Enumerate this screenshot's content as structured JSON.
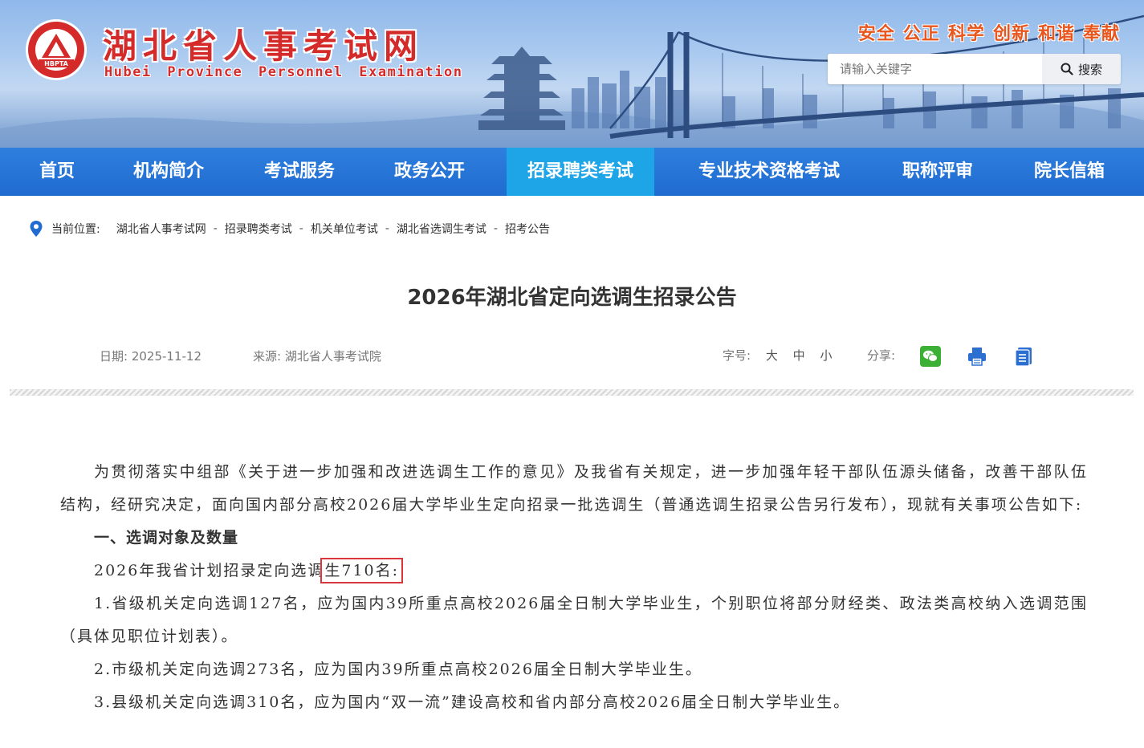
{
  "header": {
    "logo_mark": "HBPTA",
    "site_name": "湖北省人事考试网",
    "site_name_en": "Hubei Province Personnel Examination",
    "slogans": [
      "安全",
      "公正",
      "科学",
      "创新",
      "和谐",
      "奉献"
    ],
    "search": {
      "placeholder": "请输入关键字",
      "button_label": "搜索",
      "icon": "search-icon"
    }
  },
  "nav": {
    "items": [
      {
        "label": "首页"
      },
      {
        "label": "机构简介"
      },
      {
        "label": "考试服务"
      },
      {
        "label": "政务公开"
      },
      {
        "label": "招录聘类考试",
        "active": true
      },
      {
        "label": "专业技术资格考试"
      },
      {
        "label": "职称评审"
      },
      {
        "label": "院长信箱"
      }
    ],
    "colors": {
      "background": "#2574d9",
      "active": "#1ea5e8"
    }
  },
  "breadcrumb": {
    "prefix": "当前位置:",
    "icon": "location-pin-icon",
    "items": [
      "湖北省人事考试网",
      "招录聘类考试",
      "机关单位考试",
      "湖北省选调生考试",
      "招考公告"
    ],
    "separator": "-"
  },
  "article": {
    "title": "2026年湖北省定向选调生招录公告",
    "date_label": "日期:",
    "date": "2025-11-12",
    "source_label": "来源:",
    "source": "湖北省人事考试院",
    "font_size_label": "字号:",
    "font_sizes": [
      "大",
      "中",
      "小"
    ],
    "share_label": "分享:",
    "share_icons": [
      "wechat-icon",
      "print-icon",
      "document-icon"
    ],
    "intro": "为贯彻落实中组部《关于进一步加强和改进选调生工作的意见》及我省有关规定，进一步加强年轻干部队伍源头储备，改善干部队伍结构，经研究决定，面向国内部分高校2026届大学毕业生定向招录一批选调生（普通选调生招录公告另行发布），现就有关事项公告如下:",
    "section1_heading": "一、选调对象及数量",
    "plan_prefix": "2026年我省计划招录定向选调",
    "plan_highlight": "生710名:",
    "items": [
      "1.省级机关定向选调127名，应为国内39所重点高校2026届全日制大学毕业生，个别职位将部分财经类、政法类高校纳入选调范围（具体见职位计划表）。",
      "2.市级机关定向选调273名，应为国内39所重点高校2026届全日制大学毕业生。",
      "3.县级机关定向选调310名，应为国内“双一流”建设高校和省内部分高校2026届全日制大学毕业生。"
    ],
    "highlight_color": "#d9363e"
  }
}
